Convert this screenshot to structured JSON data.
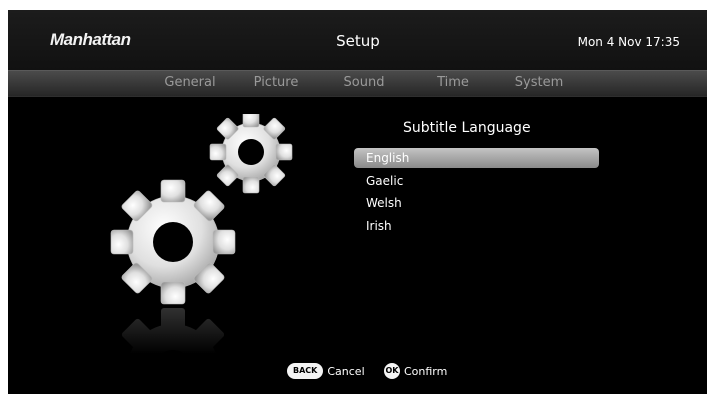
{
  "header": {
    "brand": "Manhattan",
    "title": "Setup",
    "datetime": "Mon 4 Nov 17:35"
  },
  "tabs": [
    {
      "label": "General"
    },
    {
      "label": "Picture"
    },
    {
      "label": "Sound"
    },
    {
      "label": "Time"
    },
    {
      "label": "System"
    }
  ],
  "illustration": {
    "icon": "gears-icon"
  },
  "content": {
    "title": "Subtitle Language",
    "options": [
      {
        "label": "English",
        "selected": true
      },
      {
        "label": "Gaelic",
        "selected": false
      },
      {
        "label": "Welsh",
        "selected": false
      },
      {
        "label": "Irish",
        "selected": false
      }
    ]
  },
  "footer": {
    "back_key": "BACK",
    "back_label": "Cancel",
    "ok_key": "OK",
    "ok_label": "Confirm"
  },
  "colors": {
    "background": "#000000",
    "header": "#161616",
    "tabbar": "#3a3a3a",
    "tab_text": "#9a9a9a",
    "selection": "#a8a8a8"
  }
}
